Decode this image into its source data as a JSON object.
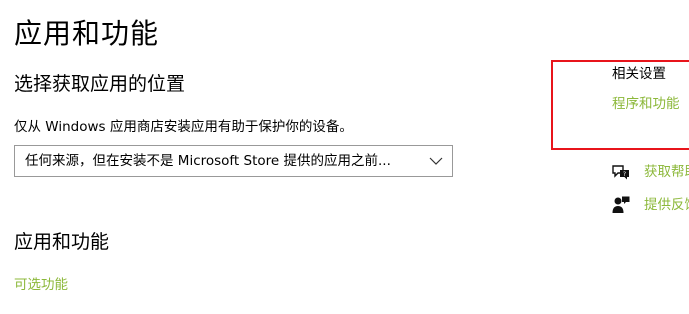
{
  "page": {
    "title": "应用和功能"
  },
  "location_section": {
    "title": "选择获取应用的位置",
    "description": "仅从 Windows 应用商店安装应用有助于保护你的设备。",
    "dropdown_value": "任何来源，但在安装不是 Microsoft Store 提供的应用之前..."
  },
  "apps_section": {
    "title": "应用和功能",
    "optional_features_link": "可选功能"
  },
  "related": {
    "title": "相关设置",
    "programs_link": "程序和功能",
    "highlight_color": "#e8141b"
  },
  "help": {
    "get_help": "获取帮助",
    "give_feedback": "提供反馈"
  },
  "icons": {
    "dropdown": "chevron-down-icon",
    "get_help": "chat-help-icon",
    "feedback": "feedback-person-icon"
  },
  "colors": {
    "link": "#8cb83a",
    "text": "#000000",
    "border": "#999999"
  }
}
